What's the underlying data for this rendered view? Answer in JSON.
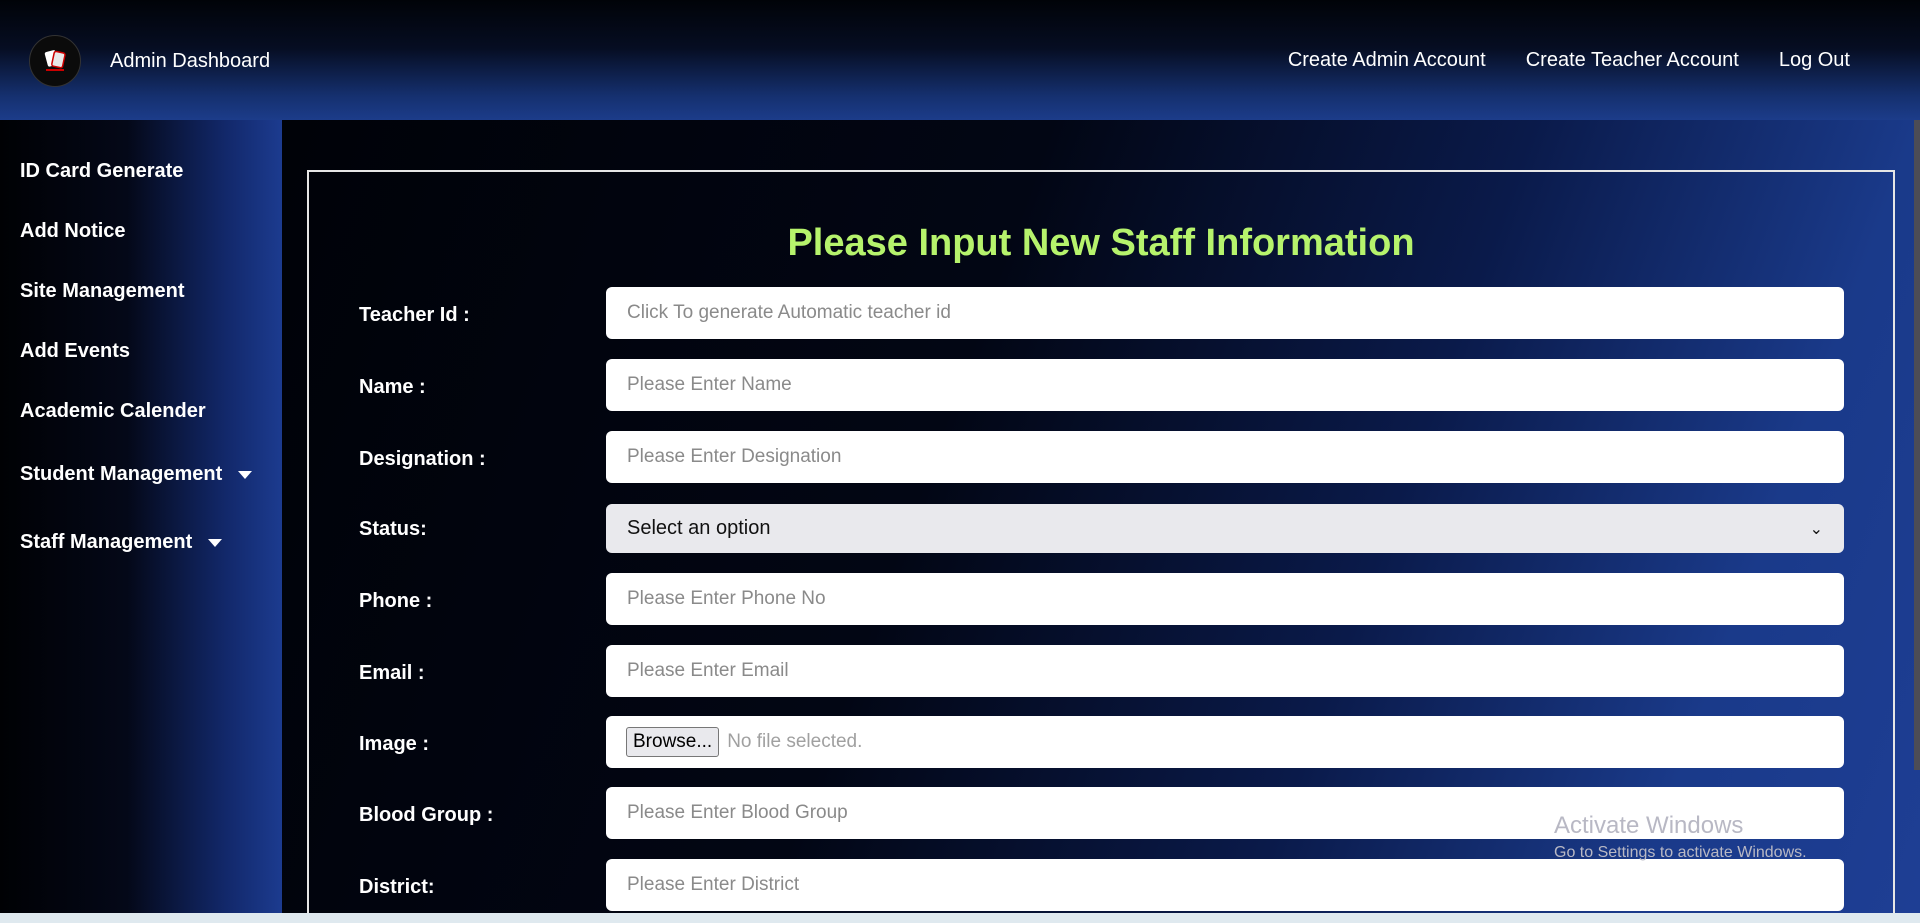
{
  "header": {
    "brand": "Admin Dashboard",
    "nav": [
      "Create Admin Account",
      "Create Teacher Account",
      "Log Out"
    ]
  },
  "sidebar": {
    "items": [
      {
        "label": "ID Card Generate"
      },
      {
        "label": "Add Notice"
      },
      {
        "label": "Site Management"
      },
      {
        "label": "Add Events"
      },
      {
        "label": "Academic Calender"
      },
      {
        "label": "Student Management",
        "dropdown": true
      },
      {
        "label": "Staff Management",
        "dropdown": true
      }
    ]
  },
  "form": {
    "title": "Please Input New Staff Information",
    "teacher_id": {
      "label": "Teacher Id :",
      "placeholder": "Click To generate Automatic teacher id"
    },
    "name": {
      "label": "Name :",
      "placeholder": "Please Enter Name"
    },
    "designation": {
      "label": "Designation :",
      "placeholder": "Please Enter Designation"
    },
    "status": {
      "label": "Status:",
      "selected": "Select an option"
    },
    "phone": {
      "label": "Phone :",
      "placeholder": "Please Enter Phone No"
    },
    "email": {
      "label": "Email :",
      "placeholder": "Please Enter Email"
    },
    "image": {
      "label": "Image :",
      "button": "Browse...",
      "file_text": "No file selected."
    },
    "blood_group": {
      "label": "Blood Group :",
      "placeholder": "Please Enter Blood Group"
    },
    "district": {
      "label": "District:",
      "placeholder": "Please Enter District"
    }
  },
  "watermark": {
    "line1": "Activate Windows",
    "line2": "Go to Settings to activate Windows."
  },
  "colors": {
    "title": "#b6f36c",
    "header_gradient_end": "#1c3c8a"
  }
}
